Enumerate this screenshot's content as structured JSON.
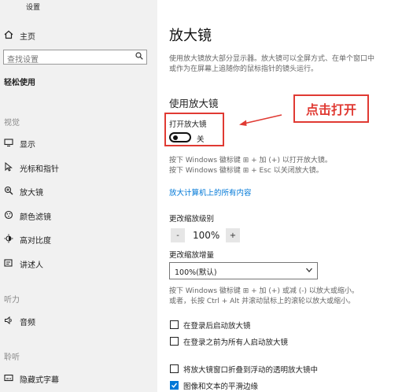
{
  "app": {
    "title": "设置"
  },
  "sidebar": {
    "home_label": "主页",
    "search_placeholder": "查找设置",
    "category": "轻松使用",
    "sections": {
      "vision": "视觉",
      "hearing": "听力",
      "interaction": "聆听"
    },
    "items": [
      {
        "label": "显示",
        "icon": "monitor-icon"
      },
      {
        "label": "光标和指针",
        "icon": "cursor-icon"
      },
      {
        "label": "放大镜",
        "icon": "magnifier-icon"
      },
      {
        "label": "颜色滤镜",
        "icon": "color-filter-icon"
      },
      {
        "label": "高对比度",
        "icon": "contrast-icon"
      },
      {
        "label": "讲述人",
        "icon": "narrator-icon"
      },
      {
        "label": "音频",
        "icon": "audio-icon"
      },
      {
        "label": "隐藏式字幕",
        "icon": "captions-icon"
      }
    ]
  },
  "main": {
    "title": "放大镜",
    "description_1": "使用放大镜放大部分显示器。放大镜可以全屏方式、在单个窗口中",
    "description_2": "或作为在屏幕上追随你的鼠标指针的镜头运行。",
    "section_title": "使用放大镜",
    "toggle_label": "打开放大镜",
    "toggle_state": "关",
    "shortcut_on": "按下 Windows 徽标键 ⊞ + 加 (+) 以打开放大镜。",
    "shortcut_off": "按下 Windows 徽标键 ⊞ + Esc 以关闭放大镜。",
    "link": "放大计算机上的所有内容",
    "zoom_level_label": "更改缩放级别",
    "zoom_minus": "-",
    "zoom_value": "100%",
    "zoom_plus": "+",
    "increment_label": "更改缩放增量",
    "increment_value": "100%(默认)",
    "increment_hint_1": "按下 Windows 徽标键 ⊞ + 加 (+) 或减 (-) 以放大或缩小。",
    "increment_hint_2": "或者，长按 Ctrl + Alt 并滚动鼠标上的滚轮以放大或缩小。",
    "checkboxes": [
      {
        "label": "在登录后启动放大镜",
        "checked": false
      },
      {
        "label": "在登录之前为所有人启动放大镜",
        "checked": false
      },
      {
        "label": "将放大镜窗口折叠到浮动的透明放大镜中",
        "checked": false
      },
      {
        "label": "图像和文本的平滑边缘",
        "checked": true
      }
    ]
  },
  "annotation": {
    "callout_text": "点击打开",
    "color": "#e03a33"
  },
  "colors": {
    "accent": "#0078d7",
    "sidebar_bg": "#f1f1f1"
  }
}
